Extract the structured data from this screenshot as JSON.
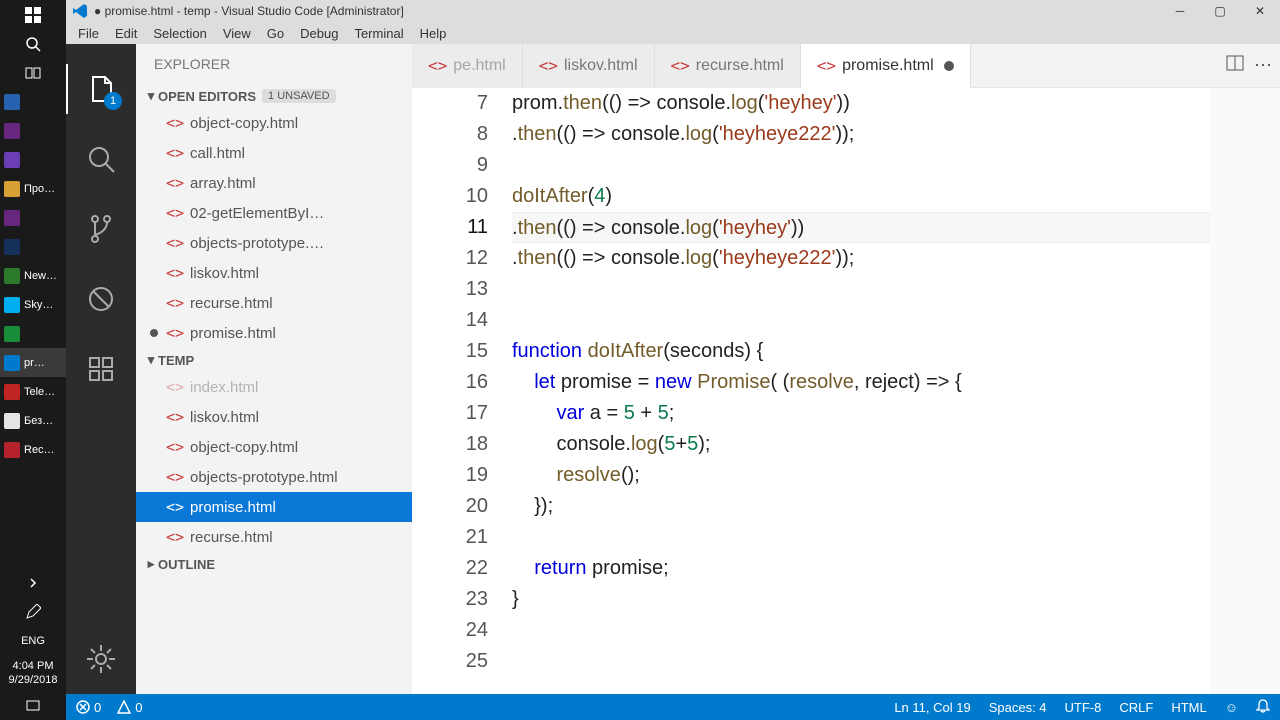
{
  "taskbar": {
    "labels": [
      "Про…",
      "New…",
      "Sky…",
      "pr…",
      "Tele…",
      "Без…",
      "Rec…"
    ],
    "lang": "ENG",
    "time": "4:04 PM",
    "date": "9/29/2018"
  },
  "window": {
    "title": "● promise.html - temp - Visual Studio Code [Administrator]",
    "menus": [
      "File",
      "Edit",
      "Selection",
      "View",
      "Go",
      "Debug",
      "Terminal",
      "Help"
    ]
  },
  "activity": {
    "badge": "1"
  },
  "explorer": {
    "title": "EXPLORER",
    "openEditors": {
      "label": "OPEN EDITORS",
      "unsaved": "1 UNSAVED",
      "items": [
        {
          "name": "object-copy.html",
          "dirty": false
        },
        {
          "name": "call.html",
          "dirty": false
        },
        {
          "name": "array.html",
          "dirty": false
        },
        {
          "name": "02-getElementByI…",
          "dirty": false
        },
        {
          "name": "objects-prototype.…",
          "dirty": false
        },
        {
          "name": "liskov.html",
          "dirty": false
        },
        {
          "name": "recurse.html",
          "dirty": false
        },
        {
          "name": "promise.html",
          "dirty": true
        }
      ]
    },
    "folder": {
      "label": "TEMP",
      "items": [
        {
          "name": "index.html",
          "muted": true
        },
        {
          "name": "liskov.html"
        },
        {
          "name": "object-copy.html"
        },
        {
          "name": "objects-prototype.html"
        },
        {
          "name": "promise.html",
          "selected": true
        },
        {
          "name": "recurse.html"
        }
      ]
    },
    "outline": "OUTLINE"
  },
  "tabs": [
    {
      "label": "pe.html",
      "partial": true
    },
    {
      "label": "liskov.html"
    },
    {
      "label": "recurse.html"
    },
    {
      "label": "promise.html",
      "active": true,
      "dirty": true
    }
  ],
  "editor": {
    "firstLine": 7,
    "currentLine": 11,
    "lines": [
      "prom.then(() => console.log('heyhey'))",
      ".then(() => console.log('heyheye222'));",
      "",
      "doItAfter(4)",
      ".then(() => console.log('heyhey'))",
      ".then(() => console.log('heyheye222'));",
      "",
      "",
      "function doItAfter(seconds) {",
      "    let promise = new Promise( (resolve, reject) => {",
      "        var a = 5 + 5;",
      "        console.log(5+5);",
      "        resolve();",
      "    });",
      "",
      "    return promise;",
      "}",
      "",
      ""
    ]
  },
  "status": {
    "errors": "0",
    "warnings": "0",
    "lncol": "Ln 11, Col 19",
    "spaces": "Spaces: 4",
    "enc": "UTF-8",
    "eol": "CRLF",
    "lang": "HTML"
  }
}
